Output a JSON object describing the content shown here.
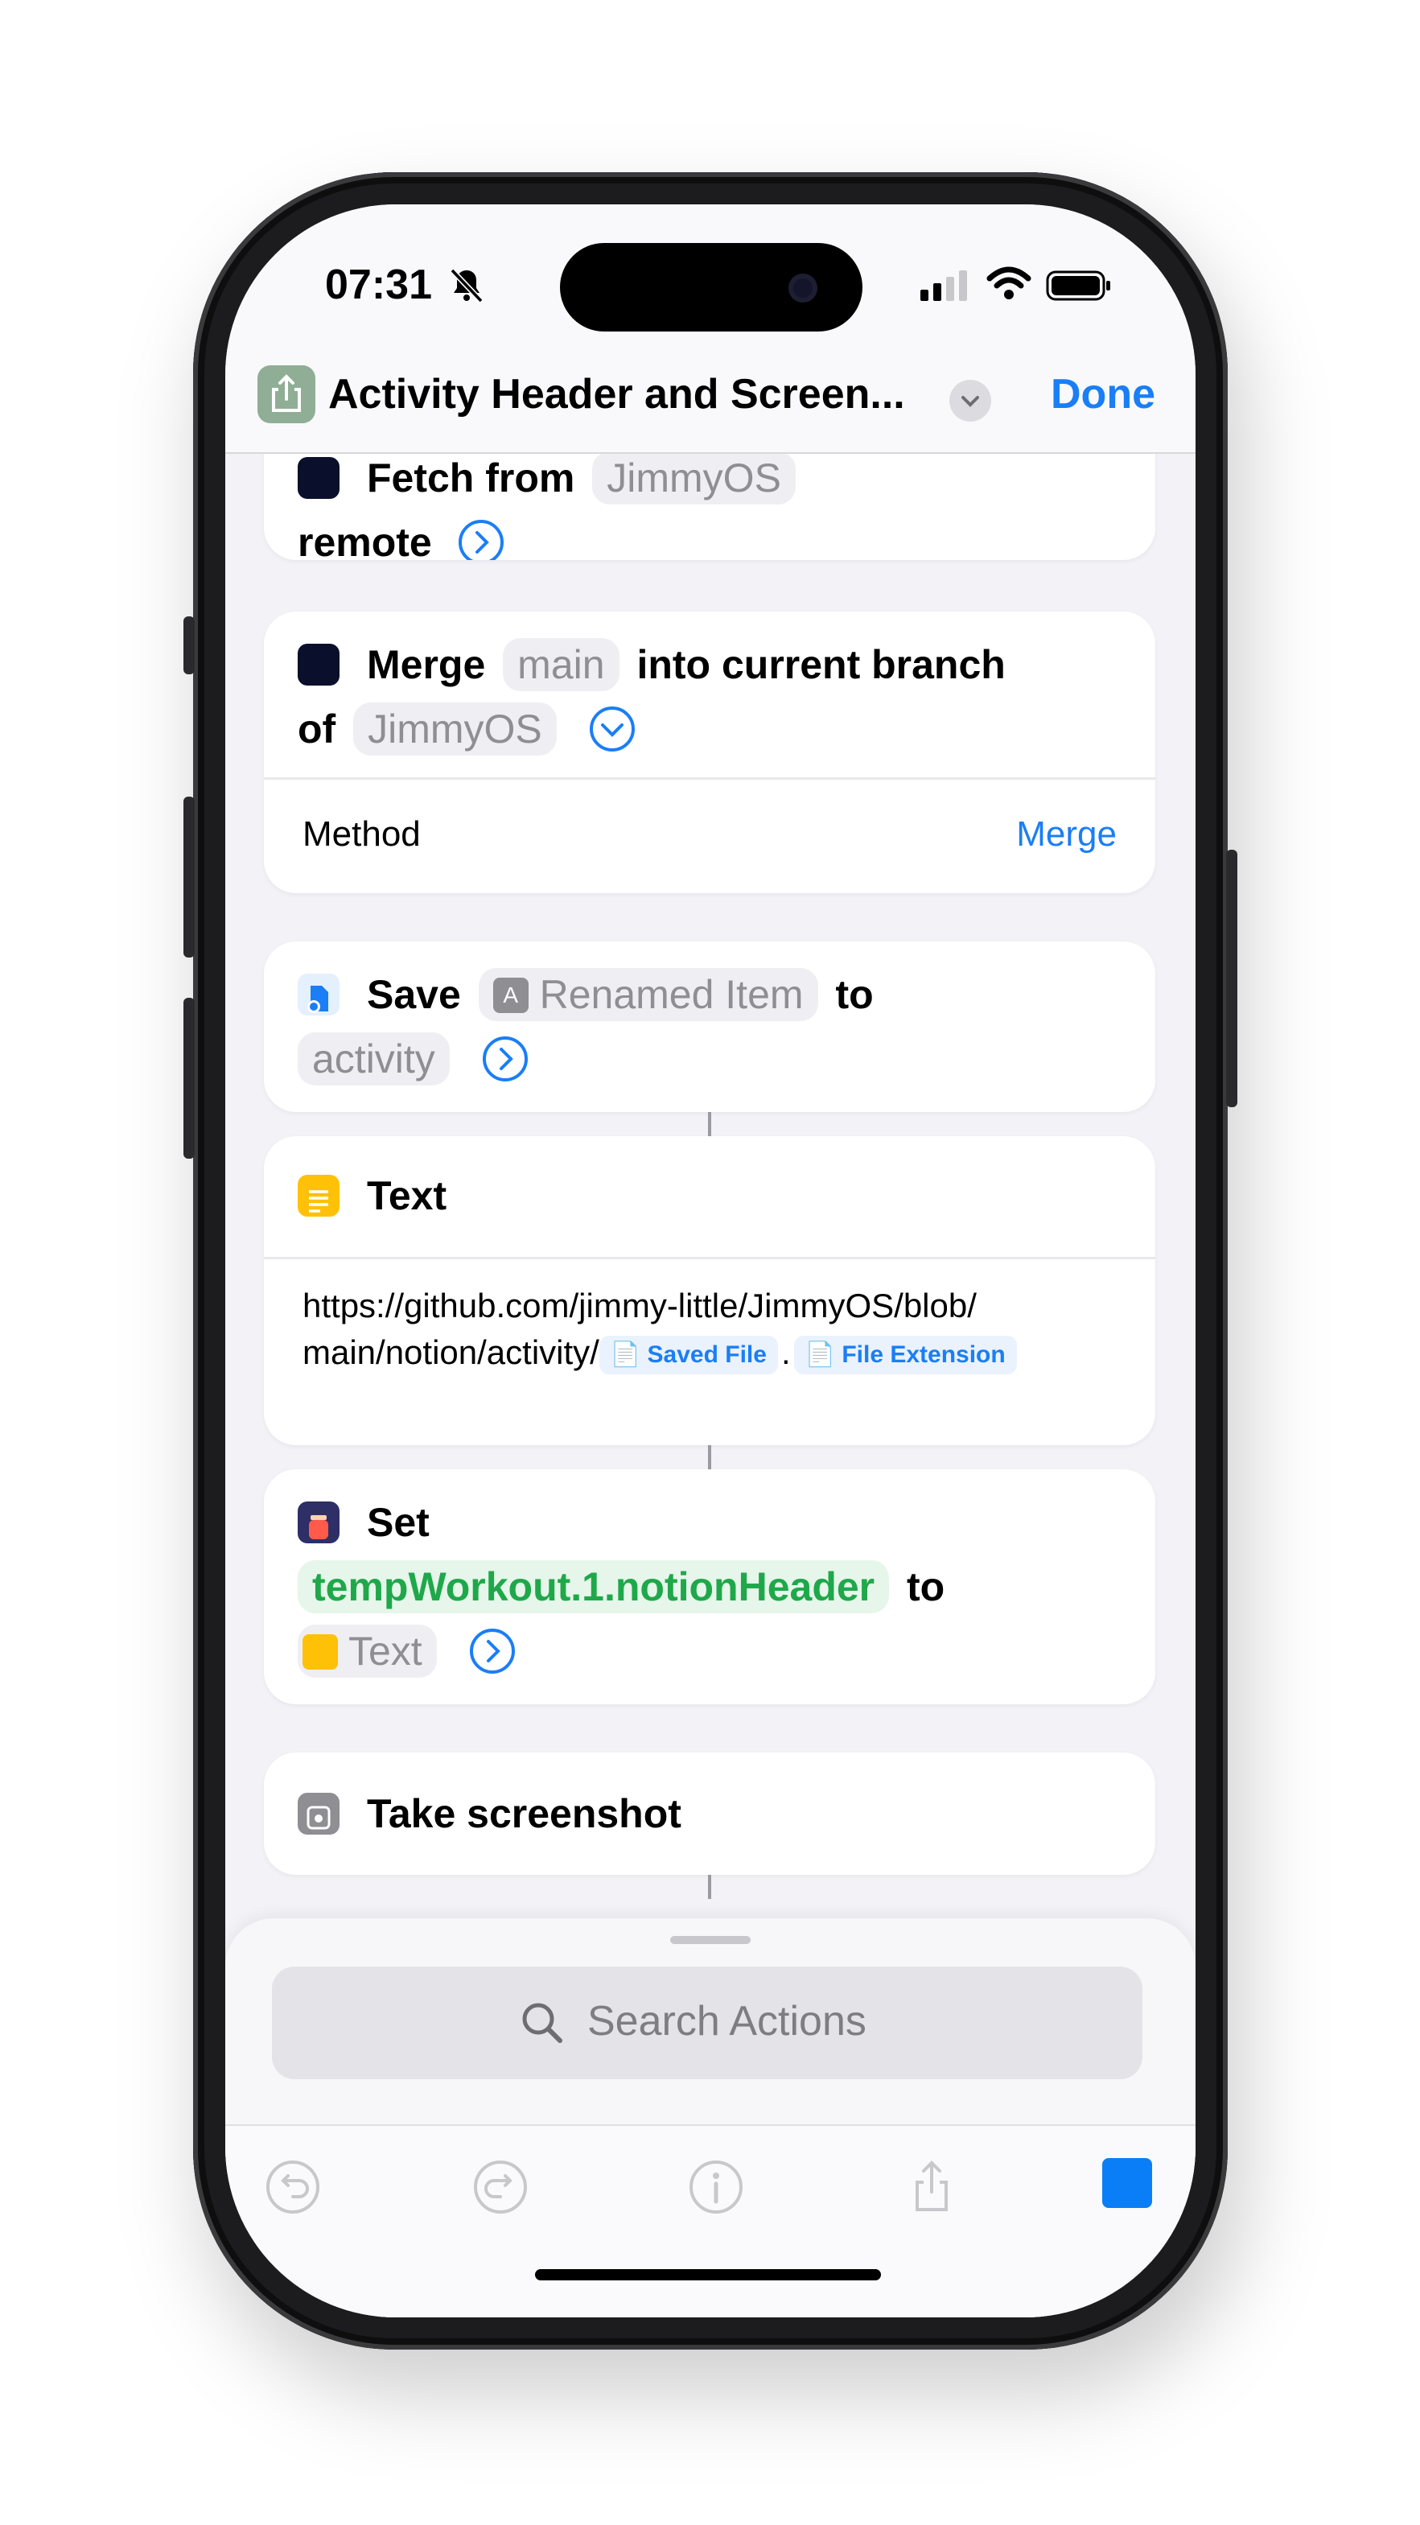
{
  "status_bar": {
    "time": "07:31"
  },
  "nav": {
    "title": "Activity Header and Screen...",
    "done_label": "Done"
  },
  "actions": {
    "fetch": {
      "verb": "Fetch from",
      "repo": "JimmyOS",
      "tail": "remote"
    },
    "merge": {
      "verb": "Merge",
      "branch": "main",
      "mid": "into current branch",
      "of": "of",
      "repo": "JimmyOS",
      "method_label": "Method",
      "method_value": "Merge"
    },
    "save": {
      "verb": "Save",
      "item": "Renamed Item",
      "to": "to",
      "dest": "activity"
    },
    "text": {
      "title": "Text",
      "url_line1": "https://github.com/jimmy-little/JimmyOS/blob/",
      "url_line2": "main/notion/activity/",
      "var1": "Saved File",
      "dot": ".",
      "var2": "File Extension"
    },
    "set": {
      "verb": "Set",
      "key": "tempWorkout.1.notionHeader",
      "to": "to",
      "value": "Text"
    },
    "screenshot": {
      "title": "Take screenshot"
    }
  },
  "search": {
    "placeholder": "Search Actions"
  },
  "toolbar": [
    "undo-icon",
    "redo-icon",
    "info-icon",
    "share-icon",
    "stop-icon"
  ],
  "colors": {
    "accent": "#1a7ef6",
    "green_var": "#1fa84a",
    "text_icon": "#ffc107"
  }
}
